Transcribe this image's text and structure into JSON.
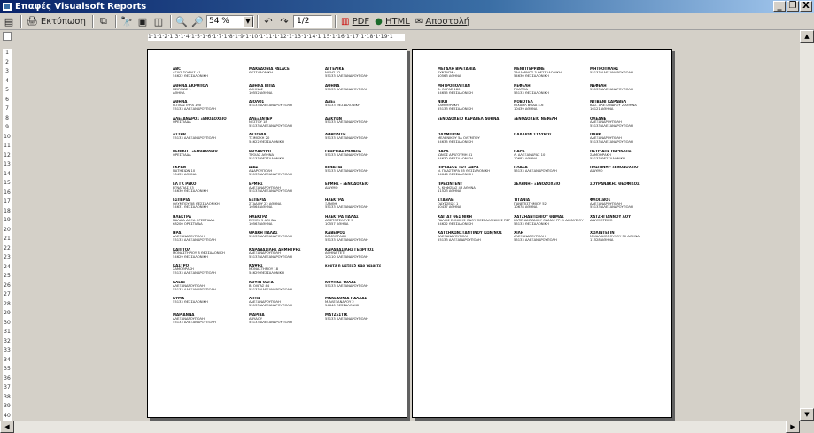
{
  "window": {
    "title": "Επαφές Visualsoft Reports",
    "buttons": [
      "_",
      "❐",
      "X"
    ]
  },
  "toolbar": {
    "print_label": "Εκτύπωση",
    "zoom_value": "54 %",
    "page_value": "1/2",
    "pdf_label": "PDF",
    "html_label": "HTML",
    "send_label": "Αποστολή"
  },
  "ruler": {
    "h": "1·1·1·2·1·3·1·4·1·5·1·6·1·7·1·8·1·9·1·10·1·11·1·12·1·13·1·14·1·15·1·16·1·17·1·18·1·19·1",
    "v": [
      "1",
      "2",
      "3",
      "4",
      "5",
      "6",
      "7",
      "8",
      "9",
      "10",
      "11",
      "12",
      "13",
      "14",
      "15",
      "16",
      "17",
      "18",
      "19",
      "20",
      "21",
      "22",
      "23",
      "24",
      "25",
      "26",
      "27",
      "28",
      "29",
      "30",
      "31",
      "32",
      "33",
      "34",
      "35",
      "36",
      "37",
      "38",
      "39",
      "40"
    ]
  },
  "pages": [
    [
      [
        "ABC",
        "ΑΓΙΑΣ ΣΟΦΙΑΣ 41",
        "54622 ΘΕΣΣΑΛΟΝΙΚΗ"
      ],
      [
        "ΜΑΚΕΔΟΝΙΑ PALACE",
        "",
        "ΘΕΣΣΑΛΟΝΙΚΗ"
      ],
      [
        "ΑΓΓΕΛΙΚΕ",
        "ΝΙΚΗΣ 32",
        "55133 ΑΛΕΞΑΝΔΡΟΥΠΟΛΗ"
      ],
      [
        "ΑΘΗΝΑ ΑΚΡΟΠΟΛ",
        "ΠΕΙΡΑΙΩΣ 1",
        "ΑΘΗΝΑ"
      ],
      [
        "ΑΘΗΝΑ ΙΠΠΑ",
        "ΑΘΗΝΑΣ",
        "10552 ΑΘΗΝΑ"
      ],
      [
        "ΑΘΗΝΑ",
        "",
        "55133 ΑΛΕΞΑΝΔΡΟΥΠΟΛΗ"
      ],
      [
        "ΑΘΗΝΑ",
        "Ν.ΠΛΑΣΤΗΡΑ 100",
        "55133 ΑΛΕΞΑΝΔΡΟΥΠΟΛΗ"
      ],
      [
        "ΑΙΟΛΟΣ",
        "",
        "55133 ΑΛΕΞΑΝΔΡΟΥΠΟΛΗ"
      ],
      [
        "ΑΛΕΞ",
        "",
        "55133 ΘΕΣΣΑΛΟΝΙΚΗ"
      ],
      [
        "ΑΛΕΞΑΝΔΡΟΣ ΞΕΝΟΔΟΧΕΙΟ",
        "",
        "ΟΡΕΣΤΙΑΔΑ"
      ],
      [
        "ΑΛΕΞΑΝΤΕΡ",
        "ΝΕΣΤΟΥ 18",
        "55133 ΑΛΕΞΑΝΔΡΟΥΠΟΛΗ"
      ],
      [
        "ΑΛΚΥΩΝ",
        "",
        "55133 ΑΛΕΞΑΝΔΡΟΥΠΟΛΗ"
      ],
      [
        "ΑΣΤΗΡ",
        "",
        "55133 ΑΛΕΞΑΝΔΡΟΥΠΟΛΗ"
      ],
      [
        "ΑΣΤΟΡΙΑ",
        "ΤΣΙΜΙΣΚΗ 20",
        "54622 ΘΕΣΣΑΛΟΝΙΚΗ"
      ],
      [
        "ΑΦΡΟΔΙΤΗ",
        "",
        "55133 ΑΛΕΞΑΝΔΡΟΥΠΟΛΗ"
      ],
      [
        "ΒΕΝΙΚΗ - ΞΕΝΟΔΟΧΕΙΟ",
        "ΟΡΕΣΤΙΑΔΑ",
        ""
      ],
      [
        "ΒΟΥΔΟΥΡΗ",
        "ΤΡΟΙΑΣ ΑΘΗΝΑ",
        "55133 ΘΕΣΣΑΛΟΝΙΚΗ"
      ],
      [
        "ΓΕΩΡΓΙΑΣ ΜΙΧΑΗΛ",
        "",
        "55133 ΑΛΕΞΑΝΔΡΟΥΠΟΛΗ"
      ],
      [
        "ΓΚΡΑΝ",
        "ΠΑΤΗΣΙΩΝ 10",
        "10433 ΑΘΗΝΑ"
      ],
      [
        "ΔΙΑΣ",
        "ΑΝΔΡΟΥΠΟΛΗ",
        "55133 ΑΛΕΞΑΝΔΡΟΥΠΟΛΗ"
      ],
      [
        "ΕΓΝΑΤΙΑ",
        "",
        "55133 ΑΛΕΞΑΝΔΡΟΥΠΟΛΗ"
      ],
      [
        "ΕΛ ΓΚ ΡΕΚΟ",
        "ΕΓΝΑΤΙΑΣ 23",
        "54630 ΘΕΣΣΑΛΟΝΙΚΗ"
      ],
      [
        "ΕΡΜΗΣ",
        "ΑΛΕΞΑΝΔΡΟΥΠΟΛΗ",
        "55133 ΑΛΕΞΑΝΔΡΟΥΠΟΛΗ"
      ],
      [
        "ΕΡΜΗΣ - ΞΕΝΟΔΟΧΕΙΟ",
        "ΔΙΔΥΜΟ",
        ""
      ],
      [
        "ΕΣΠΕΡΙΑ",
        "ΟΛΥΜΠΟΥ 58 ΘΕΣΣΑΛΟΝΙΚΗ",
        "54631 ΘΕΣΣΑΛΟΝΙΚΗ"
      ],
      [
        "ΕΣΠΕΡΙΑ",
        "ΣΤΑΔΙΟΥ 22 ΑΘΗΝΑ",
        "10564 ΑΘΗΝΑ"
      ],
      [
        "ΗΛΕΚΤΡΑ",
        "ΞΑΝΘΗ",
        "55133 ΑΛΕΞΑΝΔΡΟΥΠΟΛΗ"
      ],
      [
        "ΗΛΕΚΤΡΑ",
        "ΠΑΛΑΙΑ ΔΟΞΑ ΟΡΕΣΤΙΑΔΑ",
        "68200 ΟΡΕΣΤΙΑΔΑ"
      ],
      [
        "ΗΛΕΚΤΡΑ",
        "ΕΡΜΟΥ 5 ΑΘΗΝΑ",
        "10563 ΑΘΗΝΑ"
      ],
      [
        "ΗΛΕΚΤΡΑ ΠΑΛΑΣ",
        "ΑΡΙΣΤΟΤΕΛΟΥΣ 9",
        "10557 ΑΘΗΝΑ"
      ],
      [
        "ΗΡΑ",
        "ΑΛΕΞΑΝΔΡΟΥΠΟΛΗ",
        "55133 ΑΛΕΞΑΝΔΡΟΥΠΟΛΗ"
      ],
      [
        "ΘΡΑΚΗ ΠΑΛΑΣ",
        "",
        "55133 ΑΛΕΞΑΝΔΡΟΥΠΟΛΗ"
      ],
      [
        "ΚΑΒΕΙΡΟΣ",
        "ΣΑΜΟΘΡΑΚΗ",
        "55133 ΑΛΕΞΑΝΔΡΟΥΠΟΛΗ"
      ],
      [
        "ΚΑΠΙΤΟΛ",
        "ΜΟΝΑΣΤΗΡΙΟΥ 8 ΘΕΣΣΑΛΟΝΙΚΗ",
        "54629 ΘΕΣΣΑΛΟΝΙΚΗ"
      ],
      [
        "ΚΑΡΑΒΑΣΙΛΗΣ ΔΗΜΗΤΡΗΣ",
        "ΑΛΕΞΑΝΔΡΟΥΠΟΛΗ",
        "55133 ΑΛΕΞΑΝΔΡΟΥΠΟΛΗ"
      ],
      [
        "ΚΑΡΑΒΑΣΙΛΗΣ ΓΕΩΡΓΙΟΣ",
        "ΑΘΗΝΑ ΤΕΤΙ",
        "10110 ΑΛΕΞΑΝΔΡΟΥΠΟΛΗ"
      ],
      [
        "ΚΑΣΤΡΟ",
        "ΣΑΜΟΘΡΑΚΗ",
        "55133 ΑΛΕΞΑΝΔΡΟΥΠΟΛΗ"
      ],
      [
        "ΚΑΨΗΣ",
        "ΜΟΝΑΣΤΗΡΙΟΥ 18",
        "54629 ΘΕΣΣΑΛΟΝΙΚΗ"
      ],
      [
        "κουτλ ή ματεί 5 καρ χαιρετε",
        "",
        ""
      ],
      [
        "ΚΛΕΙΩ",
        "ΑΛΕΞΑΝΔΡΟΥΠΟΛΗ",
        "55133 ΑΛΕΞΑΝΔΡΟΥΠΟΛΗ"
      ],
      [
        "ΚΟΥΙΝ ΟΛΓΑ",
        "Β. ΟΛΓΑΣ 44",
        "55133 ΑΛΕΞΑΝΔΡΟΥΠΟΛΗ"
      ],
      [
        "ΚΟΥΠΑΣ ΤΟΛΑΣ",
        "",
        "55133 ΑΛΕΞΑΝΔΡΟΥΠΟΛΗ"
      ],
      [
        "ΚΥΜΑ",
        "",
        "55133 ΘΕΣΣΑΛΟΝΙΚΗ"
      ],
      [
        "ΛΗΤΩ",
        "ΑΛΕΞΑΝΔΡΟΥΠΟΛΗ",
        "55133 ΑΛΕΞΑΝΔΡΟΥΠΟΛΗ"
      ],
      [
        "ΜΑΚΕΔΟΝΙΑ ΠΑΛΛΑΣ",
        "Μ.ΑΛΕΞΑΝΔΡΟΥ 2",
        "54640 ΘΕΣΣΑΛΟΝΙΚΗ"
      ],
      [
        "ΜΑΡΙΑΝΝΑ",
        "ΑΛΕΞΑΝΔΡΟΥΠΟΛΗ",
        "55133 ΑΛΕΞΑΝΔΡΟΥΠΟΛΗ"
      ],
      [
        "ΜΑΡΙΒΑ",
        "ΑΒΥΔΟΥ",
        "55133 ΑΛΕΞΑΝΔΡΟΥΠΟΛΗ"
      ],
      [
        "ΜΑΤΖΕΣΤΙΚ",
        "",
        "55133 ΑΛΕΞΑΝΔΡΟΥΠΟΛΗ"
      ]
    ],
    [
      [
        "ΜΕΓΑΛΗ ΒΡΕΤΑΝΙΑ",
        "ΣΥΝΤΑΓΜΑ",
        "10563 ΑΘΗΝΑ"
      ],
      [
        "ΜΕΝΤΙΤΕΡΡΑΝΕ",
        "ΣΑΛΑΜΙΝΟΣ 3 ΘΕΣΣΑΛΟΝΙΚΗ",
        "54630 ΘΕΣΣΑΛΟΝΙΚΗ"
      ],
      [
        "ΜΗΤΡΟΠΟΛΗΣ",
        "",
        "55133 ΑΛΕΞΑΝΔΡΟΥΠΟΛΗ"
      ],
      [
        "ΜΗΤΡΟΠΟΛΙΤΑΝ",
        "Β. ΟΛΓΑΣ 180",
        "54655 ΘΕΣΣΑΛΟΝΙΚΗ"
      ],
      [
        "ΝΕΦΕΛΗ",
        "ΠΛΑΤΕΙΑ",
        "55133 ΘΕΣΣΑΛΟΝΙΚΗ"
      ],
      [
        "ΝΕΦΕΛΗ",
        "",
        "55133 ΑΛΕΞΑΝΔΡΟΥΠΟΛΗ"
      ],
      [
        "ΝΙΚΗ",
        "ΣΑΜΟΘΡΑΚΗ",
        "55133 ΘΕΣΣΑΛΟΝΙΚΗ"
      ],
      [
        "ΝΟΒΟΤΕΛ",
        "ΜΙΧΑΗΛ ΒΟΔΑ 4-6",
        "10439 ΑΘΗΝΑ"
      ],
      [
        "ΝΤΙΒΑΝΙ ΚΑΡΑΒΕΛ",
        "ΒΑΣ. ΑΛΕΞΑΝΔΡΟΥ 2 ΑΘΗΝΑ",
        "16121 ΑΘΗΝΑ"
      ],
      [
        "ΞΕΝΟΔΟΧΕΙΟ ΚΑΡΑΒΕΛ ΑΘΗΝΑ",
        "",
        ""
      ],
      [
        "ΞΕΝΟΔΟΧΕΙΟ ΝΕΦΕΛΗ",
        "",
        ""
      ],
      [
        "ΟΛΕΑΝΕ",
        "ΑΛΕΞΑΝΔΡΟΥΠΟΛΗ",
        "55133 ΑΛΕΞΑΝΔΡΟΥΠΟΛΗ"
      ],
      [
        "ΟΛΥΜΠΙΟΝ",
        "ΜΕΛΕΝΙΚΟΥ 5Α ΟΛΥΜΠΟΥ",
        "54635 ΘΕΣΣΑΛΟΝΙΚΗ"
      ],
      [
        "ΠΑΛΑΙΩΝ ΣΤΑΥΡΟΣ",
        "",
        ""
      ],
      [
        "ΠΑΡΚ",
        "ΑΛΕΞΑΝΔΡΟΥΠΟΛΗ",
        "55133 ΑΛΕΞΑΝΔΡΟΥΠΟΛΗ"
      ],
      [
        "ΠΑΡΚ",
        "ΙΩΝΟΣ ΔΡΑΓΟΥΜΗ 81",
        "54630 ΘΕΣΣΑΛΟΝΙΚΗ"
      ],
      [
        "ΠΑΡΚ",
        "Λ. ΑΛΕΞΑΝΔΡΑΣ 10",
        "10682 ΑΘΗΝΑ"
      ],
      [
        "ΠΕΤΡΙΔΗΣ ΠΕΡΙΚΛΗΣ",
        "ΣΑΜΟΘΡΑΚΗ",
        "55133 ΘΕΣΣΑΛΟΝΙΚΗ"
      ],
      [
        "ΠΙΡΓΑΣΟΣ ΤΟΥ ΧΑΡΑ",
        "Ν. ΠΛΑΣΤΗΡΑ 55 ΘΕΣΣΑΛΟΝΙΚΗ",
        "54646 ΘΕΣΣΑΛΟΝΙΚΗ"
      ],
      [
        "ΠΛΑΖΑ",
        "",
        "55133 ΑΛΕΞΑΝΔΡΟΥΠΟΛΗ"
      ],
      [
        "ΠΛΩΤΙΝΗ - ΞΕΝΟΔΟΧΕΙΟ",
        "ΔΙΔΥΜΟ",
        ""
      ],
      [
        "ΠΡΕΖΙΝΤΕΝΤ",
        "Λ. ΚΗΦΙΣΙΑΣ 43 ΑΘΗΝΑ",
        "11523 ΑΘΗΝΑ"
      ],
      [
        "ΣΕΛΗΝΗ - ΞΕΝΟΔΟΧΕΙΟ",
        "",
        ""
      ],
      [
        "ΣΟΥΡΑΝΑΚΗΣ ΘΕΟΦΙΚΟΣ",
        "",
        ""
      ],
      [
        "ΣΤΑΝΛΕΙ",
        "ΟΔΥΣΣΕΩΣ 1",
        "10437 ΑΘΗΝΑ"
      ],
      [
        "ΤΙΤΑΝΙΑ",
        "ΠΑΝΕΠΙΣΤΗΜΙΟΥ 52",
        "10678 ΑΘΗΝΑ"
      ],
      [
        "ΦΛΟΙΣΒΟΣ",
        "ΑΛΕΞΑΝΔΡΟΥΠΟΛΗ",
        "55133 ΑΛΕΞΑΝΔΡΟΥΠΟΛΗ"
      ],
      [
        "ΧΑΓΙΑΤ ΘΕΣ ΝΙΚΗ",
        "ΠΑΛΙΑΣ ΕΘΝΙΚΗΣ ΟΔΟΥ ΘΕΣΣΑΛΟΝΙΚΗΣ ΠΕΡΑΙΑΣ 2",
        "54622 ΘΕΣΣΑΛΟΝΙΚΗ"
      ],
      [
        "ΧΑΤΖΗΑΝΤΩΝΙΟΥ ΘΩΜΑΣ",
        "ΧΑΤΖΗΑΝΤΩΝΙΟΥ ΘΩΜΑΣ ΓΡ. Λ ΔΙΟΝΥΣΙΟΥ",
        "55133 ΘΕΣΣΑΛΟΝΙΚΗ"
      ],
      [
        "ΧΑΤΖΗΓΙΑΝΝΟΥ ΛΟΥ",
        "ΔΙΔΥΜΟΤΕΙΧΟ",
        ""
      ],
      [
        "ΧΑΤΖΗΚΩΝΣΤΑΝΤΙΝΟΥ ΚΩΝ/ΝΟΣ",
        "ΑΛΕΞΑΝΔΡΟΥΠΟΛΗ",
        "55133 ΑΛΕΞΑΝΔΡΟΥΠΟΛΗ"
      ],
      [
        "ΧΙΛΗ",
        "ΑΛΕΞΑΝΔΡΟΥΠΟΛΗ",
        "55133 ΑΛΕΞΑΝΔΡΟΥΠΟΛΗ"
      ],
      [
        "ΧΟΛΙΝΤΕΙ ΙΝ",
        "ΜΙΧΑΛΑΚΟΠΟΥΛΟΥ 50 ΑΘΗΝΑ",
        "11528 ΑΘΗΝΑ"
      ]
    ]
  ]
}
